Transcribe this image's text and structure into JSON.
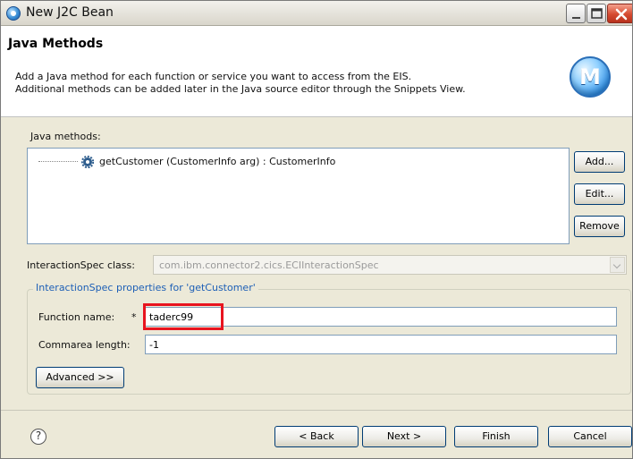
{
  "window": {
    "title": "New J2C Bean",
    "controls": {
      "minimize": "minimize-icon",
      "maximize": "maximize-icon",
      "close": "close-icon"
    }
  },
  "header": {
    "title": "Java Methods",
    "description_line1": "Add a Java method for each function or service you want to access from the EIS.",
    "description_line2": "Additional methods can be added later in the Java source editor through the Snippets View.",
    "logo_text": "M"
  },
  "java_methods": {
    "label": "Java methods:",
    "items": [
      {
        "label": "getCustomer (CustomerInfo arg) : CustomerInfo",
        "icon": "method-gear-icon"
      }
    ],
    "buttons": {
      "add": "Add...",
      "edit": "Edit...",
      "remove": "Remove"
    }
  },
  "interaction_spec": {
    "label": "InteractionSpec class:",
    "value": "com.ibm.connector2.cics.ECIInteractionSpec"
  },
  "properties": {
    "legend": "InteractionSpec properties for 'getCustomer'",
    "function_name_label": "Function name:",
    "required_marker": "*",
    "function_name_value": "taderc99",
    "commarea_label": "Commarea length:",
    "commarea_value": "-1",
    "advanced_button": "Advanced >>"
  },
  "footer": {
    "help_icon": "?",
    "back": "< Back",
    "next": "Next >",
    "finish": "Finish",
    "cancel": "Cancel"
  },
  "colors": {
    "highlight": "#e8141f",
    "legend_text": "#1d5fb6",
    "dialog_bg": "#ece9d8"
  }
}
